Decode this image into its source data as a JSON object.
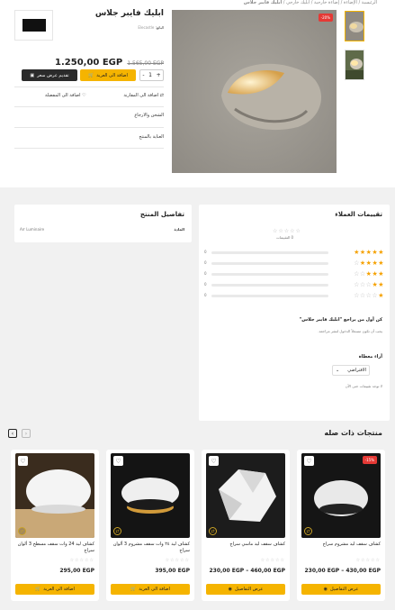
{
  "breadcrumb": {
    "items": [
      "الرئيسية",
      "الإضاءة",
      "إضاءة خارجية",
      "أبليك خارجي"
    ],
    "current": "ابليك فايبر جلاس"
  },
  "product": {
    "title": "ابليك فايبر جلاس",
    "brand_label": "البائع:",
    "brand_value": "Elecastle",
    "price": "1.250,00 EGP",
    "old_price": "1.565,00 EGP",
    "quantity": "1",
    "qty_minus": "-",
    "qty_plus": "+",
    "add_to_cart": "اضافة الى العربة",
    "request_quote": "تقديم عرض سعر",
    "compare": "اضافة الى المقارنة",
    "wishlist": "اضافة الى المفضلة",
    "shipping": "الشحن والارجاع",
    "care": "العناية بالمنتج",
    "sale_badge": "-20%"
  },
  "details": {
    "title": "تفاصيل المنتج",
    "spec_label": "المادة",
    "spec_value": "Arr Luminaire"
  },
  "reviews": {
    "title": "تقييمات العملاء",
    "avg_stars": "☆☆☆☆☆",
    "count_text": "0 التقييمات",
    "rows": [
      {
        "filled": "★★★★★",
        "empty": "",
        "count": "0"
      },
      {
        "filled": "★★★★",
        "empty": "☆",
        "count": "0"
      },
      {
        "filled": "★★★",
        "empty": "☆☆",
        "count": "0"
      },
      {
        "filled": "★★",
        "empty": "☆☆☆",
        "count": "0"
      },
      {
        "filled": "★",
        "empty": "☆☆☆☆",
        "count": "0"
      }
    ],
    "first_review": "كن أول من يراجع \"ابليك فايبر جلاس\"",
    "login_note": "يجب أن تكون مسجلاً الدخول لنشر مراجعة.",
    "opinions_label": "أراء معطاة",
    "sort_value": "الافتراضي",
    "no_reviews": "لا توجد تقييمات حتى الآن"
  },
  "related": {
    "title": "منتجات ذات صله",
    "products": [
      {
        "title": "كشاف سقف ليد مشروم سراج",
        "stars": "☆☆☆☆☆",
        "price": "230,00 EGP – 430,00 EGP",
        "button": "عرض التفاصيل",
        "badge": "-15%",
        "icon": "eye-icon"
      },
      {
        "title": "كشاف سقف ليد ماسي سراج",
        "stars": "☆☆☆☆☆",
        "price": "230,00 EGP – 460,00 EGP",
        "button": "عرض التفاصيل",
        "badge": "",
        "icon": "eye-icon"
      },
      {
        "title": "كشاف ليد ٢٤ وات سقف مشروم 3 ألوان سراج",
        "stars": "☆☆☆☆☆",
        "price": "395,00 EGP",
        "button": "اضافة الى العربة",
        "badge": "",
        "icon": "cart-icon"
      },
      {
        "title": "كشاف ليد 24 وات سقف مسطح 3 ألوان سراج",
        "stars": "☆☆☆☆☆",
        "price": "295,00 EGP",
        "button": "اضافة الى العربة",
        "badge": "",
        "icon": "cart-icon"
      }
    ]
  },
  "colors": {
    "accent": "#f5b400",
    "dark": "#2b2b2b",
    "sale": "#e53935",
    "bg": "#f1f1f1"
  }
}
